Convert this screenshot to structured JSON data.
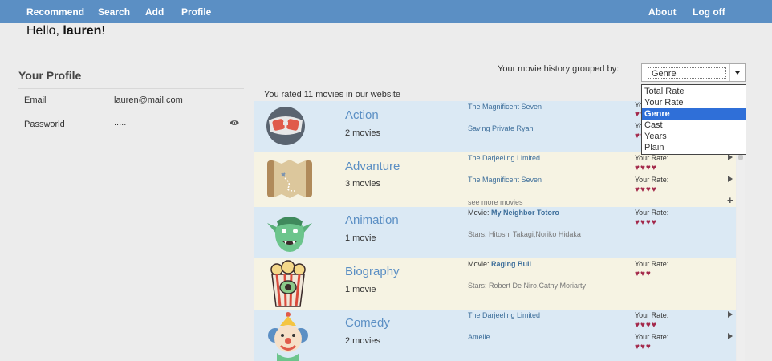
{
  "nav": {
    "recommend": "Recommend",
    "search": "Search",
    "add": "Add",
    "profile": "Profile",
    "about": "About",
    "logoff": "Log off"
  },
  "greeting": {
    "prefix": "Hello, ",
    "username": "lauren",
    "suffix": "!"
  },
  "profile": {
    "title": "Your Profile",
    "email_label": "Email",
    "email_value": "lauren@mail.com",
    "password_label": "Passworld",
    "password_value": ".....",
    "reveal_icon": "eye-icon"
  },
  "history": {
    "label": "Your movie history grouped by:",
    "selected": "Genre",
    "options": [
      "Total Rate",
      "Your Rate",
      "Genre",
      "Cast",
      "Years",
      "Plain"
    ]
  },
  "summary": "You rated 11 movies in our website",
  "colors": {
    "nav": "#5b8fc4",
    "heart": "#a3284a",
    "row_blue": "#dbe9f4",
    "row_cream": "#f6f3e3",
    "selected_option": "#2f6fd8"
  },
  "groups": [
    {
      "genre": "Action",
      "count": "2 movies",
      "icon": "superhero-mask-icon",
      "movies": [
        {
          "title": "The Magnificent Seven",
          "rate_label": "Your Rate:",
          "hearts": "♥♥♥♥"
        },
        {
          "title": "Saving Private Ryan",
          "rate_label": "Your Rate:",
          "hearts": "♥♥"
        }
      ]
    },
    {
      "genre": "Advanture",
      "count": "3 movies",
      "icon": "treasure-map-icon",
      "see_more": "see more movies",
      "movies": [
        {
          "title": "The Darjeeling Limited",
          "rate_label": "Your Rate:",
          "hearts": "♥♥♥♥"
        },
        {
          "title": "The Magnificent Seven",
          "rate_label": "Your Rate:",
          "hearts": "♥♥♥♥"
        }
      ]
    },
    {
      "genre": "Animation",
      "count": "1 movie",
      "icon": "goblin-icon",
      "movie_prefix": "Movie: ",
      "movie_title": "My Neighbor Totoro",
      "stars": "Stars: Hitoshi Takagi,Noriko Hidaka",
      "rate_label": "Your Rate:",
      "hearts": "♥♥♥♥"
    },
    {
      "genre": "Biography",
      "count": "1 movie",
      "icon": "popcorn-icon",
      "movie_prefix": "Movie: ",
      "movie_title": "Raging Bull",
      "stars": "Stars: Robert De Niro,Cathy Moriarty",
      "rate_label": "Your Rate:",
      "hearts": "♥♥♥"
    },
    {
      "genre": "Comedy",
      "count": "2 movies",
      "icon": "clown-icon",
      "movies": [
        {
          "title": "The Darjeeling Limited",
          "rate_label": "Your Rate:",
          "hearts": "♥♥♥♥"
        },
        {
          "title": "Amelie",
          "rate_label": "Your Rate:",
          "hearts": "♥♥♥"
        }
      ]
    }
  ]
}
